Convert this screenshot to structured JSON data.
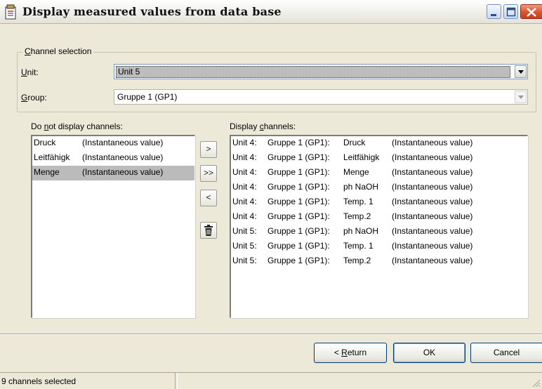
{
  "window": {
    "title": "Display measured values from data base"
  },
  "channel_selection": {
    "legend": "Channel selection",
    "legend_mnemonic": "C",
    "legend_rest": "hannel selection",
    "unit_label_mnemonic": "U",
    "unit_label_rest": "nit:",
    "unit_value": "Unit 5",
    "group_label_mnemonic": "G",
    "group_label_rest": "roup:",
    "group_value": "Gruppe 1 (GP1)"
  },
  "not_displayed": {
    "label_pre": "Do ",
    "label_mnemonic": "n",
    "label_post": "ot display channels:",
    "rows": [
      {
        "channel": "Druck",
        "type": "(Instantaneous value)",
        "selected": false
      },
      {
        "channel": "Leitfähigk",
        "type": "(Instantaneous value)",
        "selected": false
      },
      {
        "channel": "Menge",
        "type": "(Instantaneous value)",
        "selected": true
      }
    ]
  },
  "displayed": {
    "label_pre": "Display ",
    "label_mnemonic": "c",
    "label_post": "hannels:",
    "rows": [
      {
        "unit": "Unit 4:",
        "group": "Gruppe 1 (GP1):",
        "channel": "Druck",
        "type": "(Instantaneous value)"
      },
      {
        "unit": "Unit 4:",
        "group": "Gruppe 1 (GP1):",
        "channel": "Leitfähigk",
        "type": "(Instantaneous value)"
      },
      {
        "unit": "Unit 4:",
        "group": "Gruppe 1 (GP1):",
        "channel": "Menge",
        "type": "(Instantaneous value)"
      },
      {
        "unit": "Unit 4:",
        "group": "Gruppe 1 (GP1):",
        "channel": "ph NaOH",
        "type": "(Instantaneous value)"
      },
      {
        "unit": "Unit 4:",
        "group": "Gruppe 1 (GP1):",
        "channel": "Temp. 1",
        "type": "(Instantaneous value)"
      },
      {
        "unit": "Unit 4:",
        "group": "Gruppe 1 (GP1):",
        "channel": "Temp.2",
        "type": "(Instantaneous value)"
      },
      {
        "unit": "Unit 5:",
        "group": "Gruppe 1 (GP1):",
        "channel": "ph NaOH",
        "type": "(Instantaneous value)"
      },
      {
        "unit": "Unit 5:",
        "group": "Gruppe 1 (GP1):",
        "channel": "Temp. 1",
        "type": "(Instantaneous value)"
      },
      {
        "unit": "Unit 5:",
        "group": "Gruppe 1 (GP1):",
        "channel": "Temp.2",
        "type": "(Instantaneous value)"
      }
    ]
  },
  "move_buttons": {
    "add_one": ">",
    "add_all": ">>",
    "remove_one": "<",
    "delete_icon": "trash-icon"
  },
  "footer": {
    "return_pre": "< ",
    "return_mnemonic": "R",
    "return_post": "eturn",
    "ok": "OK",
    "cancel": "Cancel"
  },
  "status": {
    "text": "9 channels selected"
  },
  "colors": {
    "close_button": "#d9542c",
    "selection": "#bbbbbb",
    "border_blue": "#7f9db9"
  }
}
